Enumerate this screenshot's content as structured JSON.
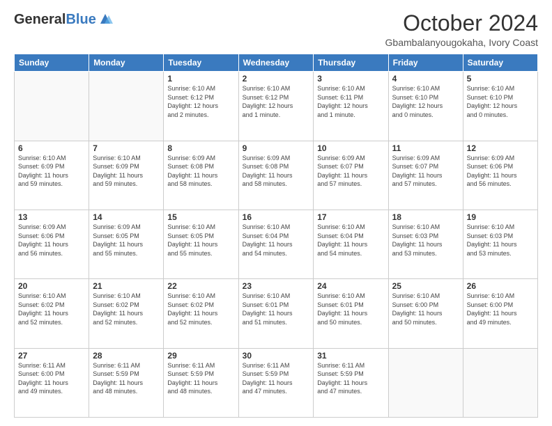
{
  "header": {
    "logo_general": "General",
    "logo_blue": "Blue",
    "month_title": "October 2024",
    "location": "Gbambalanyougokaha, Ivory Coast"
  },
  "days_of_week": [
    "Sunday",
    "Monday",
    "Tuesday",
    "Wednesday",
    "Thursday",
    "Friday",
    "Saturday"
  ],
  "weeks": [
    [
      {
        "day": "",
        "info": ""
      },
      {
        "day": "",
        "info": ""
      },
      {
        "day": "1",
        "info": "Sunrise: 6:10 AM\nSunset: 6:12 PM\nDaylight: 12 hours\nand 2 minutes."
      },
      {
        "day": "2",
        "info": "Sunrise: 6:10 AM\nSunset: 6:12 PM\nDaylight: 12 hours\nand 1 minute."
      },
      {
        "day": "3",
        "info": "Sunrise: 6:10 AM\nSunset: 6:11 PM\nDaylight: 12 hours\nand 1 minute."
      },
      {
        "day": "4",
        "info": "Sunrise: 6:10 AM\nSunset: 6:10 PM\nDaylight: 12 hours\nand 0 minutes."
      },
      {
        "day": "5",
        "info": "Sunrise: 6:10 AM\nSunset: 6:10 PM\nDaylight: 12 hours\nand 0 minutes."
      }
    ],
    [
      {
        "day": "6",
        "info": "Sunrise: 6:10 AM\nSunset: 6:09 PM\nDaylight: 11 hours\nand 59 minutes."
      },
      {
        "day": "7",
        "info": "Sunrise: 6:10 AM\nSunset: 6:09 PM\nDaylight: 11 hours\nand 59 minutes."
      },
      {
        "day": "8",
        "info": "Sunrise: 6:09 AM\nSunset: 6:08 PM\nDaylight: 11 hours\nand 58 minutes."
      },
      {
        "day": "9",
        "info": "Sunrise: 6:09 AM\nSunset: 6:08 PM\nDaylight: 11 hours\nand 58 minutes."
      },
      {
        "day": "10",
        "info": "Sunrise: 6:09 AM\nSunset: 6:07 PM\nDaylight: 11 hours\nand 57 minutes."
      },
      {
        "day": "11",
        "info": "Sunrise: 6:09 AM\nSunset: 6:07 PM\nDaylight: 11 hours\nand 57 minutes."
      },
      {
        "day": "12",
        "info": "Sunrise: 6:09 AM\nSunset: 6:06 PM\nDaylight: 11 hours\nand 56 minutes."
      }
    ],
    [
      {
        "day": "13",
        "info": "Sunrise: 6:09 AM\nSunset: 6:06 PM\nDaylight: 11 hours\nand 56 minutes."
      },
      {
        "day": "14",
        "info": "Sunrise: 6:09 AM\nSunset: 6:05 PM\nDaylight: 11 hours\nand 55 minutes."
      },
      {
        "day": "15",
        "info": "Sunrise: 6:10 AM\nSunset: 6:05 PM\nDaylight: 11 hours\nand 55 minutes."
      },
      {
        "day": "16",
        "info": "Sunrise: 6:10 AM\nSunset: 6:04 PM\nDaylight: 11 hours\nand 54 minutes."
      },
      {
        "day": "17",
        "info": "Sunrise: 6:10 AM\nSunset: 6:04 PM\nDaylight: 11 hours\nand 54 minutes."
      },
      {
        "day": "18",
        "info": "Sunrise: 6:10 AM\nSunset: 6:03 PM\nDaylight: 11 hours\nand 53 minutes."
      },
      {
        "day": "19",
        "info": "Sunrise: 6:10 AM\nSunset: 6:03 PM\nDaylight: 11 hours\nand 53 minutes."
      }
    ],
    [
      {
        "day": "20",
        "info": "Sunrise: 6:10 AM\nSunset: 6:02 PM\nDaylight: 11 hours\nand 52 minutes."
      },
      {
        "day": "21",
        "info": "Sunrise: 6:10 AM\nSunset: 6:02 PM\nDaylight: 11 hours\nand 52 minutes."
      },
      {
        "day": "22",
        "info": "Sunrise: 6:10 AM\nSunset: 6:02 PM\nDaylight: 11 hours\nand 52 minutes."
      },
      {
        "day": "23",
        "info": "Sunrise: 6:10 AM\nSunset: 6:01 PM\nDaylight: 11 hours\nand 51 minutes."
      },
      {
        "day": "24",
        "info": "Sunrise: 6:10 AM\nSunset: 6:01 PM\nDaylight: 11 hours\nand 50 minutes."
      },
      {
        "day": "25",
        "info": "Sunrise: 6:10 AM\nSunset: 6:00 PM\nDaylight: 11 hours\nand 50 minutes."
      },
      {
        "day": "26",
        "info": "Sunrise: 6:10 AM\nSunset: 6:00 PM\nDaylight: 11 hours\nand 49 minutes."
      }
    ],
    [
      {
        "day": "27",
        "info": "Sunrise: 6:11 AM\nSunset: 6:00 PM\nDaylight: 11 hours\nand 49 minutes."
      },
      {
        "day": "28",
        "info": "Sunrise: 6:11 AM\nSunset: 5:59 PM\nDaylight: 11 hours\nand 48 minutes."
      },
      {
        "day": "29",
        "info": "Sunrise: 6:11 AM\nSunset: 5:59 PM\nDaylight: 11 hours\nand 48 minutes."
      },
      {
        "day": "30",
        "info": "Sunrise: 6:11 AM\nSunset: 5:59 PM\nDaylight: 11 hours\nand 47 minutes."
      },
      {
        "day": "31",
        "info": "Sunrise: 6:11 AM\nSunset: 5:59 PM\nDaylight: 11 hours\nand 47 minutes."
      },
      {
        "day": "",
        "info": ""
      },
      {
        "day": "",
        "info": ""
      }
    ]
  ]
}
